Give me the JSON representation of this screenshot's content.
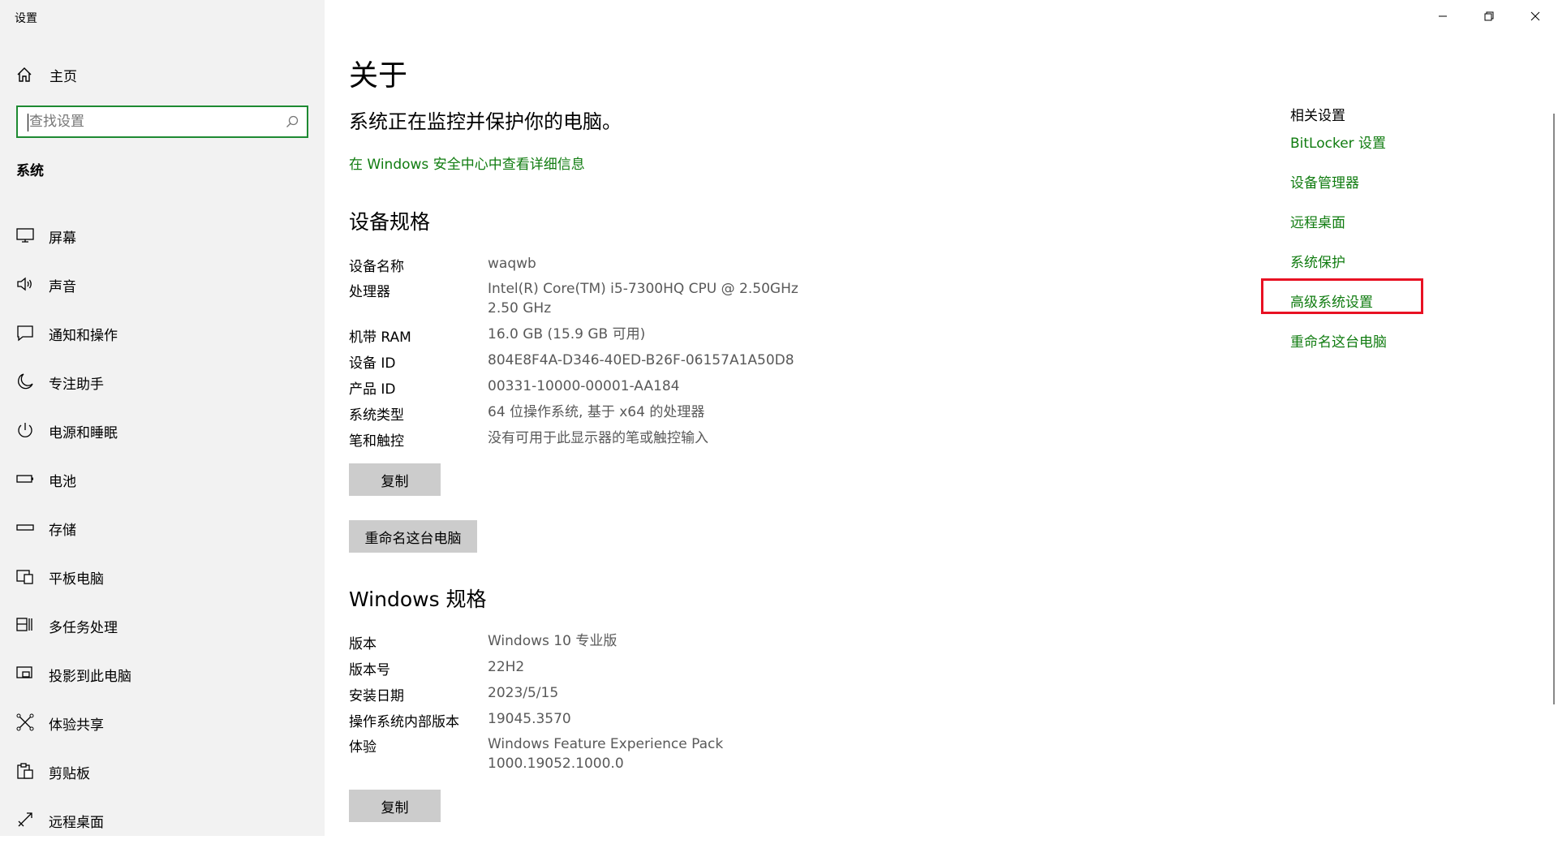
{
  "app": {
    "title": "设置"
  },
  "sidebar": {
    "home_label": "主页",
    "search_placeholder": "查找设置",
    "section_title": "系统",
    "items": [
      {
        "label": "屏幕",
        "icon": "monitor-icon"
      },
      {
        "label": "声音",
        "icon": "speaker-icon"
      },
      {
        "label": "通知和操作",
        "icon": "notification-icon"
      },
      {
        "label": "专注助手",
        "icon": "moon-icon"
      },
      {
        "label": "电源和睡眠",
        "icon": "power-icon"
      },
      {
        "label": "电池",
        "icon": "battery-icon"
      },
      {
        "label": "存储",
        "icon": "storage-icon"
      },
      {
        "label": "平板电脑",
        "icon": "tablet-icon"
      },
      {
        "label": "多任务处理",
        "icon": "multitask-icon"
      },
      {
        "label": "投影到此电脑",
        "icon": "project-icon"
      },
      {
        "label": "体验共享",
        "icon": "share-icon"
      },
      {
        "label": "剪贴板",
        "icon": "clipboard-icon"
      },
      {
        "label": "远程桌面",
        "icon": "remote-icon"
      }
    ]
  },
  "main": {
    "title": "关于",
    "protect_text": "系统正在监控并保护你的电脑。",
    "security_link": "在 Windows 安全中心中查看详细信息",
    "device_spec_title": "设备规格",
    "device_specs": [
      {
        "key": "设备名称",
        "value": "waqwb"
      },
      {
        "key": "处理器",
        "value": "Intel(R) Core(TM) i5-7300HQ CPU @ 2.50GHz",
        "value2": "2.50 GHz"
      },
      {
        "key": "机带 RAM",
        "value": "16.0 GB (15.9 GB 可用)"
      },
      {
        "key": "设备 ID",
        "value": "804E8F4A-D346-40ED-B26F-06157A1A50D8"
      },
      {
        "key": "产品 ID",
        "value": "00331-10000-00001-AA184"
      },
      {
        "key": "系统类型",
        "value": "64 位操作系统, 基于 x64 的处理器"
      },
      {
        "key": "笔和触控",
        "value": "没有可用于此显示器的笔或触控输入"
      }
    ],
    "copy_button": "复制",
    "rename_button": "重命名这台电脑",
    "windows_spec_title": "Windows 规格",
    "windows_specs": [
      {
        "key": "版本",
        "value": "Windows 10 专业版"
      },
      {
        "key": "版本号",
        "value": "22H2"
      },
      {
        "key": "安装日期",
        "value": "2023/5/15"
      },
      {
        "key": "操作系统内部版本",
        "value": "19045.3570"
      },
      {
        "key": "体验",
        "value": "Windows Feature Experience Pack",
        "value2": "1000.19052.1000.0"
      }
    ],
    "copy_button_2": "复制"
  },
  "related": {
    "title": "相关设置",
    "links": [
      "BitLocker 设置",
      "设备管理器",
      "远程桌面",
      "系统保护",
      "高级系统设置",
      "重命名这台电脑"
    ],
    "highlighted_index": 4
  },
  "colors": {
    "accent": "#107c10",
    "sidebar_bg": "#f2f2f2",
    "highlight": "#e81123",
    "button_bg": "#cccccc"
  }
}
